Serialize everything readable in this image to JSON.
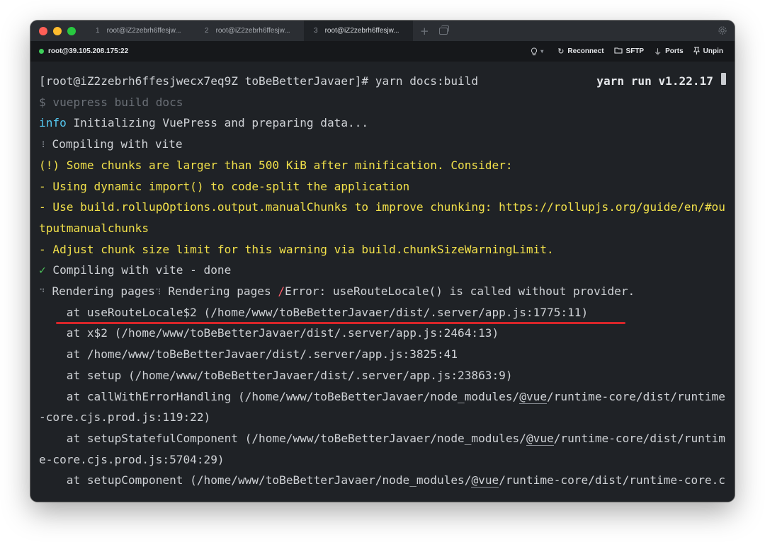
{
  "window": {
    "traffic_lights": [
      "close",
      "minimize",
      "zoom"
    ],
    "tabs": [
      {
        "num": "1",
        "label": "root@iZ2zebrh6ffesjw..."
      },
      {
        "num": "2",
        "label": "root@iZ2zebrh6ffesjw..."
      },
      {
        "num": "3",
        "label": "root@iZ2zebrh6ffesjw...",
        "active": true
      }
    ],
    "new_tab_icon": "plus-icon",
    "settings_icon": "gear-icon"
  },
  "infobar": {
    "host": "root@39.105.208.175:22",
    "status_color": "#3ecf5a",
    "bulb_icon": "lightbulb-icon",
    "reconnect": "Reconnect",
    "sftp": "SFTP",
    "ports": "Ports",
    "unpin": "Unpin"
  },
  "terminal": {
    "version": "yarn run v1.22.17",
    "lines": {
      "l1": "[root@iZ2zebrh6ffesjwecx7eq9Z toBeBetterJavaer]# yarn docs:build",
      "l2": "$ vuepress build docs",
      "l3_a": "info",
      "l3_b": " Initializing VuePress and preparing data...",
      "l4_a": "⠸",
      "l4_b": " Compiling with vite",
      "l5": "(!) Some chunks are larger than 500 KiB after minification. Consider:",
      "l6": "- Using dynamic import() to code-split the application",
      "l7": "- Use build.rollupOptions.output.manualChunks to improve chunking: https://rollupjs.org/guide/en/#ou",
      "l8": "tputmanualchunks",
      "l9": "- Adjust chunk size limit for this warning via build.chunkSizeWarningLimit.",
      "l10_a": "✓",
      "l10_b": " Compiling with vite - done",
      "l11_a": "⠙",
      "l11_b": " Rendering pages",
      "l11_c": "⠹",
      "l11_d": " Rendering pages ",
      "l11_e": "/",
      "l11_f": "Error: useRouteLocale() is called without provider.",
      "l12": "    at useRouteLocale$2 (/home/www/toBeBetterJavaer/dist/.server/app.js:1775:11)",
      "l13": "    at x$2 (/home/www/toBeBetterJavaer/dist/.server/app.js:2464:13)",
      "l14": "    at /home/www/toBeBetterJavaer/dist/.server/app.js:3825:41",
      "l15": "    at setup (/home/www/toBeBetterJavaer/dist/.server/app.js:23863:9)",
      "l16_a": "    at callWithErrorHandling (/home/www/toBeBetterJavaer/node_modules/",
      "l16_b": "@vue",
      "l16_c": "/runtime-core/dist/runtime",
      "l17": "-core.cjs.prod.js:119:22)",
      "l18_a": "    at setupStatefulComponent (/home/www/toBeBetterJavaer/node_modules/",
      "l18_b": "@vue",
      "l18_c": "/runtime-core/dist/runtim",
      "l19": "e-core.cjs.prod.js:5704:29)",
      "l20_a": "    at setupComponent (/home/www/toBeBetterJavaer/node_modules/",
      "l20_b": "@vue",
      "l20_c": "/runtime-core/dist/runtime-core.c"
    }
  },
  "colors": {
    "warning": "#f2e14a",
    "info": "#55c7ef",
    "success": "#4cc25b",
    "error_underline": "#d7262a"
  }
}
